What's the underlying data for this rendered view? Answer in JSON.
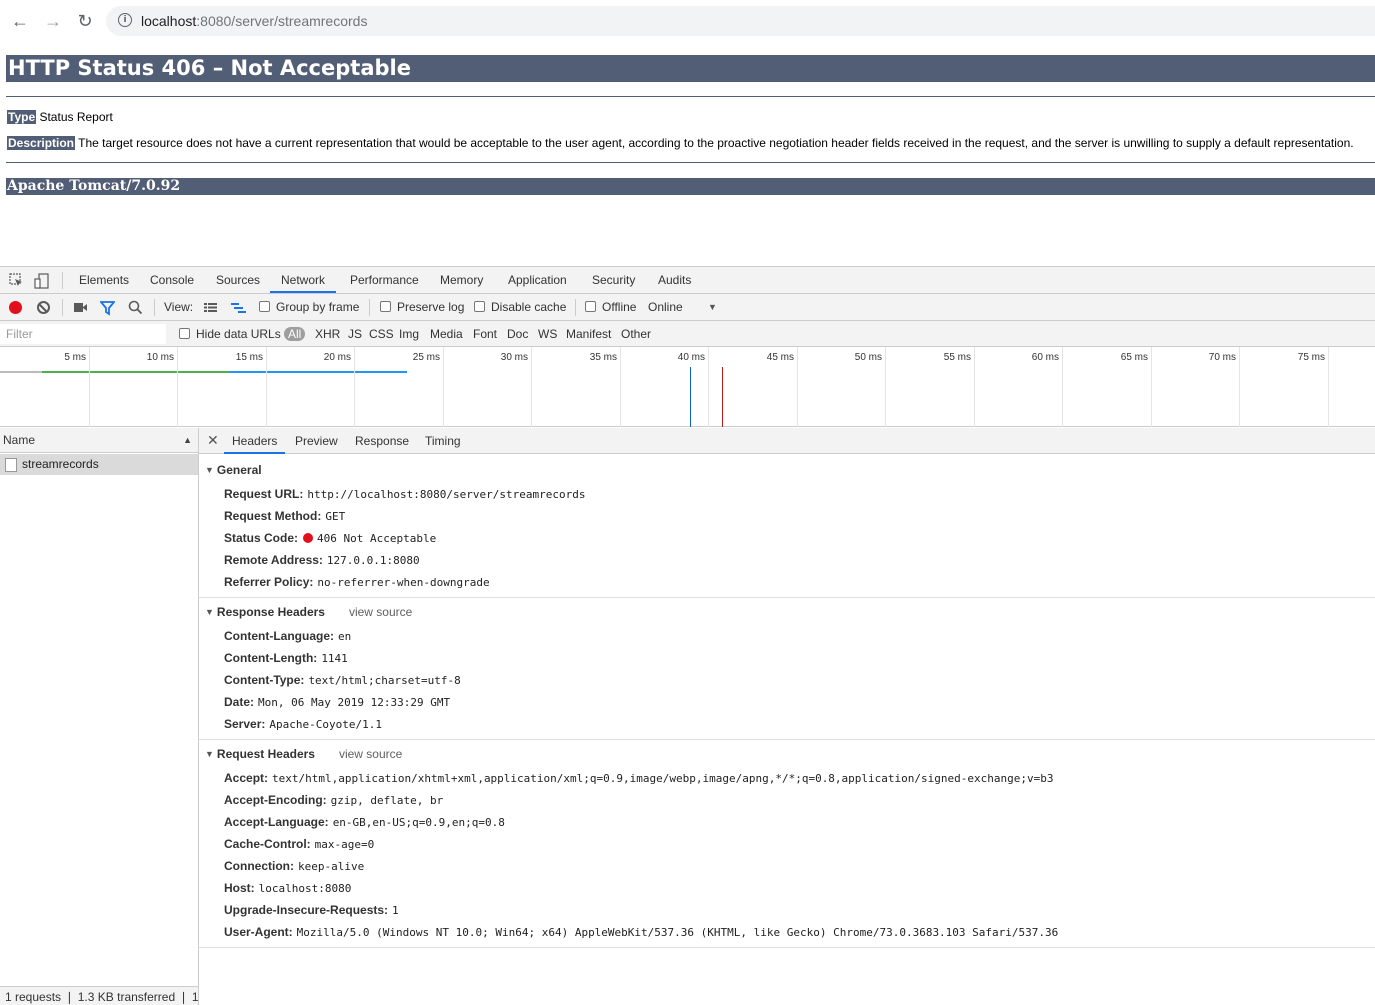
{
  "browser": {
    "url_host": "localhost",
    "url_rest": ":8080/server/streamrecords"
  },
  "tomcat": {
    "title": "HTTP Status 406 – Not Acceptable",
    "type_label": "Type",
    "type_value": "Status Report",
    "description_label": "Description",
    "description_value": "The target resource does not have a current representation that would be acceptable to the user agent, according to the proactive negotiation header fields received in the request, and the server is unwilling to supply a default representation.",
    "footer": "Apache Tomcat/7.0.92",
    "colors": {
      "header_bg": "#525d76"
    }
  },
  "devtools": {
    "tabs": [
      "Elements",
      "Console",
      "Sources",
      "Network",
      "Performance",
      "Memory",
      "Application",
      "Security",
      "Audits"
    ],
    "active_tab": "Network",
    "toolbar": {
      "view_label": "View:",
      "group_by_frame": "Group by frame",
      "preserve_log": "Preserve log",
      "disable_cache": "Disable cache",
      "offline": "Offline",
      "throttle": "Online"
    },
    "filter": {
      "placeholder": "Filter",
      "hide_data_urls": "Hide data URLs",
      "types": [
        "All",
        "XHR",
        "JS",
        "CSS",
        "Img",
        "Media",
        "Font",
        "Doc",
        "WS",
        "Manifest",
        "Other"
      ]
    },
    "timeline_labels": [
      "5 ms",
      "10 ms",
      "15 ms",
      "20 ms",
      "25 ms",
      "30 ms",
      "35 ms",
      "40 ms",
      "45 ms",
      "50 ms",
      "55 ms",
      "60 ms",
      "65 ms",
      "70 ms",
      "75 ms"
    ],
    "name_column": "Name",
    "requests": [
      "streamrecords"
    ],
    "summary": "1 requests  ❘  1.3 KB transferred  ❘  1...",
    "detail_tabs": [
      "Headers",
      "Preview",
      "Response",
      "Timing"
    ],
    "general": {
      "title": "General",
      "rows": [
        {
          "name": "Request URL:",
          "value": "http://localhost:8080/server/streamrecords"
        },
        {
          "name": "Request Method:",
          "value": "GET"
        },
        {
          "name": "Status Code:",
          "value": "406 Not Acceptable"
        },
        {
          "name": "Remote Address:",
          "value": "127.0.0.1:8080"
        },
        {
          "name": "Referrer Policy:",
          "value": "no-referrer-when-downgrade"
        }
      ]
    },
    "response_headers": {
      "title": "Response Headers",
      "view_source": "view source",
      "rows": [
        {
          "name": "Content-Language:",
          "value": "en"
        },
        {
          "name": "Content-Length:",
          "value": "1141"
        },
        {
          "name": "Content-Type:",
          "value": "text/html;charset=utf-8"
        },
        {
          "name": "Date:",
          "value": "Mon, 06 May 2019 12:33:29 GMT"
        },
        {
          "name": "Server:",
          "value": "Apache-Coyote/1.1"
        }
      ]
    },
    "request_headers": {
      "title": "Request Headers",
      "view_source": "view source",
      "rows": [
        {
          "name": "Accept:",
          "value": "text/html,application/xhtml+xml,application/xml;q=0.9,image/webp,image/apng,*/*;q=0.8,application/signed-exchange;v=b3"
        },
        {
          "name": "Accept-Encoding:",
          "value": "gzip, deflate, br"
        },
        {
          "name": "Accept-Language:",
          "value": "en-GB,en-US;q=0.9,en;q=0.8"
        },
        {
          "name": "Cache-Control:",
          "value": "max-age=0"
        },
        {
          "name": "Connection:",
          "value": "keep-alive"
        },
        {
          "name": "Host:",
          "value": "localhost:8080"
        },
        {
          "name": "Upgrade-Insecure-Requests:",
          "value": "1"
        },
        {
          "name": "User-Agent:",
          "value": "Mozilla/5.0 (Windows NT 10.0; Win64; x64) AppleWebKit/537.36 (KHTML, like Gecko) Chrome/73.0.3683.103 Safari/537.36"
        }
      ]
    }
  }
}
